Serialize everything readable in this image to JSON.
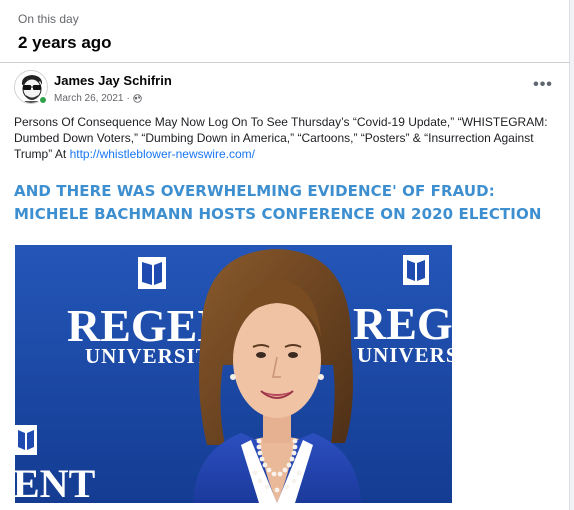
{
  "memory": {
    "kicker": "On this day",
    "title": "2 years ago"
  },
  "post": {
    "author": "James Jay Schifrin",
    "date": "March 26, 2021",
    "privacy_separator": "·",
    "audience_icon": "globe-icon",
    "more_label": "•••",
    "text": "Persons Of Consequence May Now Log On To See Thursday’s “Covid-19 Update,” “WHISTEGRAM: Dumbed Down Voters,” “Dumbing Down in America,” “Cartoons,” “Posters” & “Insurrection Against Trump”  At ",
    "link_text": "http://whistleblower-newswire.com/"
  },
  "headline": {
    "line1": "AND THERE WAS OVERWHELMING EVIDENCE' OF FRAUD:",
    "line2": "MICHELE BACHMANN HOSTS CONFERENCE ON 2020 ELECTION"
  },
  "photo": {
    "backdrop_left_word": "REGEN",
    "backdrop_left_sub": "UNIVERSIT",
    "backdrop_right_word": "REGE",
    "backdrop_right_sub": "UNIVERS",
    "backdrop_bottom_word": "ENT"
  },
  "colors": {
    "headline": "#3e8fd0",
    "backdrop": "#1848a6",
    "link": "#1877f2",
    "online": "#31a24c"
  }
}
